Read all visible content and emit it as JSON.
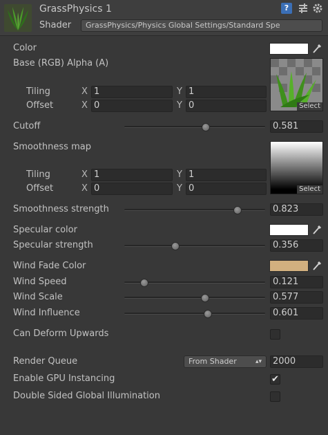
{
  "header": {
    "material_name": "GrassPhysics 1",
    "shader_label": "Shader",
    "shader_value": "GrassPhysics/Physics Global Settings/Standard Spe",
    "help_glyph": "?"
  },
  "properties": {
    "color": {
      "label": "Color",
      "swatch": "#ffffff"
    },
    "base_map": {
      "label": "Base (RGB) Alpha (A)",
      "select_label": "Select",
      "tiling_label": "Tiling",
      "tiling_x": "1",
      "tiling_y": "1",
      "offset_label": "Offset",
      "offset_x": "0",
      "offset_y": "0"
    },
    "cutoff": {
      "label": "Cutoff",
      "value": "0.581",
      "fraction": 0.581
    },
    "smoothness_map": {
      "label": "Smoothness map",
      "select_label": "Select",
      "tiling_label": "Tiling",
      "tiling_x": "1",
      "tiling_y": "1",
      "offset_label": "Offset",
      "offset_x": "0",
      "offset_y": "0"
    },
    "smoothness_strength": {
      "label": "Smoothness strength",
      "value": "0.823",
      "fraction": 0.823
    },
    "specular_color": {
      "label": "Specular color",
      "swatch": "#ffffff"
    },
    "specular_strength": {
      "label": "Specular strength",
      "value": "0.356",
      "fraction": 0.356
    },
    "wind_fade_color": {
      "label": "Wind Fade Color",
      "swatch": "#d2b07f"
    },
    "wind_speed": {
      "label": "Wind Speed",
      "value": "0.121",
      "fraction": 0.121
    },
    "wind_scale": {
      "label": "Wind Scale",
      "value": "0.577",
      "fraction": 0.577
    },
    "wind_influence": {
      "label": "Wind Influence",
      "value": "0.601",
      "fraction": 0.601
    },
    "can_deform_upwards": {
      "label": "Can Deform Upwards",
      "checked": false
    }
  },
  "advanced": {
    "render_queue": {
      "label": "Render Queue",
      "dropdown": "From Shader",
      "value": "2000"
    },
    "gpu_instancing": {
      "label": "Enable GPU Instancing",
      "checked": true
    },
    "double_sided_gi": {
      "label": "Double Sided Global Illumination",
      "checked": false
    }
  },
  "axis_labels": {
    "x": "X",
    "y": "Y"
  },
  "icons": {
    "material": "grass-material-icon",
    "help": "help-icon",
    "preset": "preset-icon",
    "settings": "gear-icon",
    "picker": "eyedropper-icon",
    "check": "checkmark-icon"
  },
  "colors": {
    "background": "#383838",
    "field": "#2c2c2c",
    "text": "#c2c2c2",
    "help_blue": "#3b6fb6"
  }
}
